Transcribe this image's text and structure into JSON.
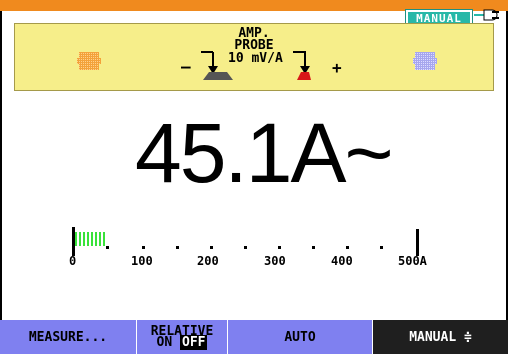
{
  "mode_badge": "MANUAL",
  "probe": {
    "title": "AMP.",
    "subtitle": "PROBE",
    "scale": "10 mV/A",
    "minus": "–",
    "plus": "+"
  },
  "reading": "45.1A~",
  "bargraph": {
    "fill_fraction": 0.063,
    "ticks": [
      "0",
      "100",
      "200",
      "300",
      "400",
      "500A"
    ]
  },
  "softkeys": {
    "measure": "MEASURE...",
    "relative": "RELATIVE",
    "relative_on": "ON",
    "relative_off": "OFF",
    "auto": "AUTO",
    "manual": "MANUAL ≑"
  },
  "colors": {
    "top_bar": "#f08a1e",
    "panel": "#f6ee8a",
    "badge": "#27b8a8",
    "softkey": "#7f80f0",
    "bar_fill": "#39e23a"
  },
  "icons": [
    "plug-icon",
    "probe-arrow-icon",
    "black-connector-icon",
    "red-connector-icon",
    "input-jack-icon"
  ]
}
